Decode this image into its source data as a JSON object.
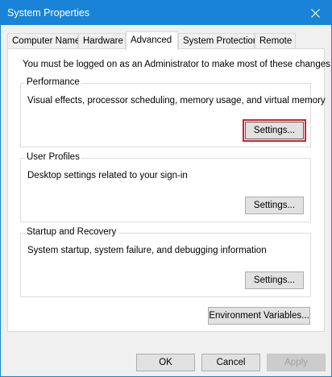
{
  "window": {
    "title": "System Properties",
    "close_icon": "close-icon"
  },
  "tabs": [
    {
      "label": "Computer Name",
      "active": false
    },
    {
      "label": "Hardware",
      "active": false
    },
    {
      "label": "Advanced",
      "active": true
    },
    {
      "label": "System Protection",
      "active": false
    },
    {
      "label": "Remote",
      "active": false
    }
  ],
  "notice": "You must be logged on as an Administrator to make most of these changes.",
  "groups": {
    "performance": {
      "title": "Performance",
      "description": "Visual effects, processor scheduling, memory usage, and virtual memory",
      "button": "Settings..."
    },
    "user_profiles": {
      "title": "User Profiles",
      "description": "Desktop settings related to your sign-in",
      "button": "Settings..."
    },
    "startup": {
      "title": "Startup and Recovery",
      "description": "System startup, system failure, and debugging information",
      "button": "Settings..."
    }
  },
  "env_button": "Environment Variables...",
  "footer": {
    "ok": "OK",
    "cancel": "Cancel",
    "apply": "Apply"
  },
  "colors": {
    "titlebar": "#1883d7",
    "highlight": "#d1202b"
  }
}
